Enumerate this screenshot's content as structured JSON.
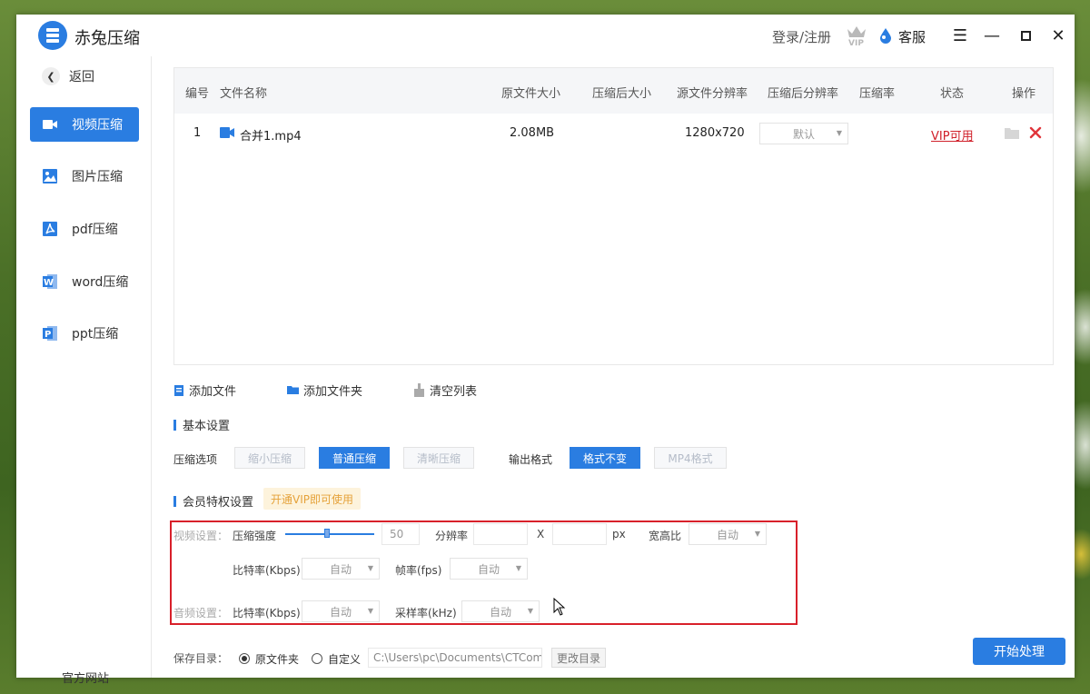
{
  "app": {
    "title": "赤兔压缩",
    "login": "登录/注册",
    "support": "客服"
  },
  "sidebar": {
    "back": "返回",
    "items": [
      {
        "label": "视频压缩",
        "icon": "video-icon",
        "active": true
      },
      {
        "label": "图片压缩",
        "icon": "image-icon",
        "active": false
      },
      {
        "label": "pdf压缩",
        "icon": "pdf-icon",
        "active": false
      },
      {
        "label": "word压缩",
        "icon": "word-icon",
        "active": false
      },
      {
        "label": "ppt压缩",
        "icon": "ppt-icon",
        "active": false
      }
    ],
    "official_site": "官方网站"
  },
  "table": {
    "headers": [
      "编号",
      "文件名称",
      "原文件大小",
      "压缩后大小",
      "源文件分辨率",
      "压缩后分辨率",
      "压缩率",
      "状态",
      "操作"
    ],
    "rows": [
      {
        "index": "1",
        "name": "合并1.mp4",
        "size": "2.08MB",
        "compressed_size": "",
        "resolution": "1280x720",
        "target_resolution": "默认",
        "ratio": "",
        "status": "VIP可用"
      }
    ]
  },
  "toolbar": {
    "add_file": "添加文件",
    "add_folder": "添加文件夹",
    "clear_list": "清空列表"
  },
  "basic": {
    "title": "基本设置",
    "compress_label": "压缩选项",
    "compress_options": [
      "缩小压缩",
      "普通压缩",
      "清晰压缩"
    ],
    "compress_selected": 1,
    "format_label": "输出格式",
    "format_options": [
      "格式不变",
      "MP4格式"
    ],
    "format_selected": 0
  },
  "member": {
    "title": "会员特权设置",
    "badge": "开通VIP即可使用",
    "video_label": "视频设置：",
    "strength_label": "压缩强度",
    "strength_value": "50",
    "resolution_label": "分辨率",
    "x_label": "X",
    "px_label": "px",
    "aspect_label": "宽高比",
    "aspect_value": "自动",
    "bitrate_label": "比特率(Kbps)",
    "bitrate_value": "自动",
    "fps_label": "帧率(fps)",
    "fps_value": "自动",
    "audio_label": "音频设置：",
    "audio_bitrate_label": "比特率(Kbps)",
    "audio_bitrate_value": "自动",
    "sample_label": "采样率(kHz)",
    "sample_value": "自动"
  },
  "save": {
    "label": "保存目录：",
    "original": "原文件夹",
    "custom": "自定义",
    "path": "C:\\Users\\pc\\Documents\\CTCom",
    "change": "更改目录"
  },
  "start_button": "开始处理",
  "colors": {
    "accent": "#2a7de1",
    "danger": "#d8202a",
    "vip": "#e5a23a"
  }
}
